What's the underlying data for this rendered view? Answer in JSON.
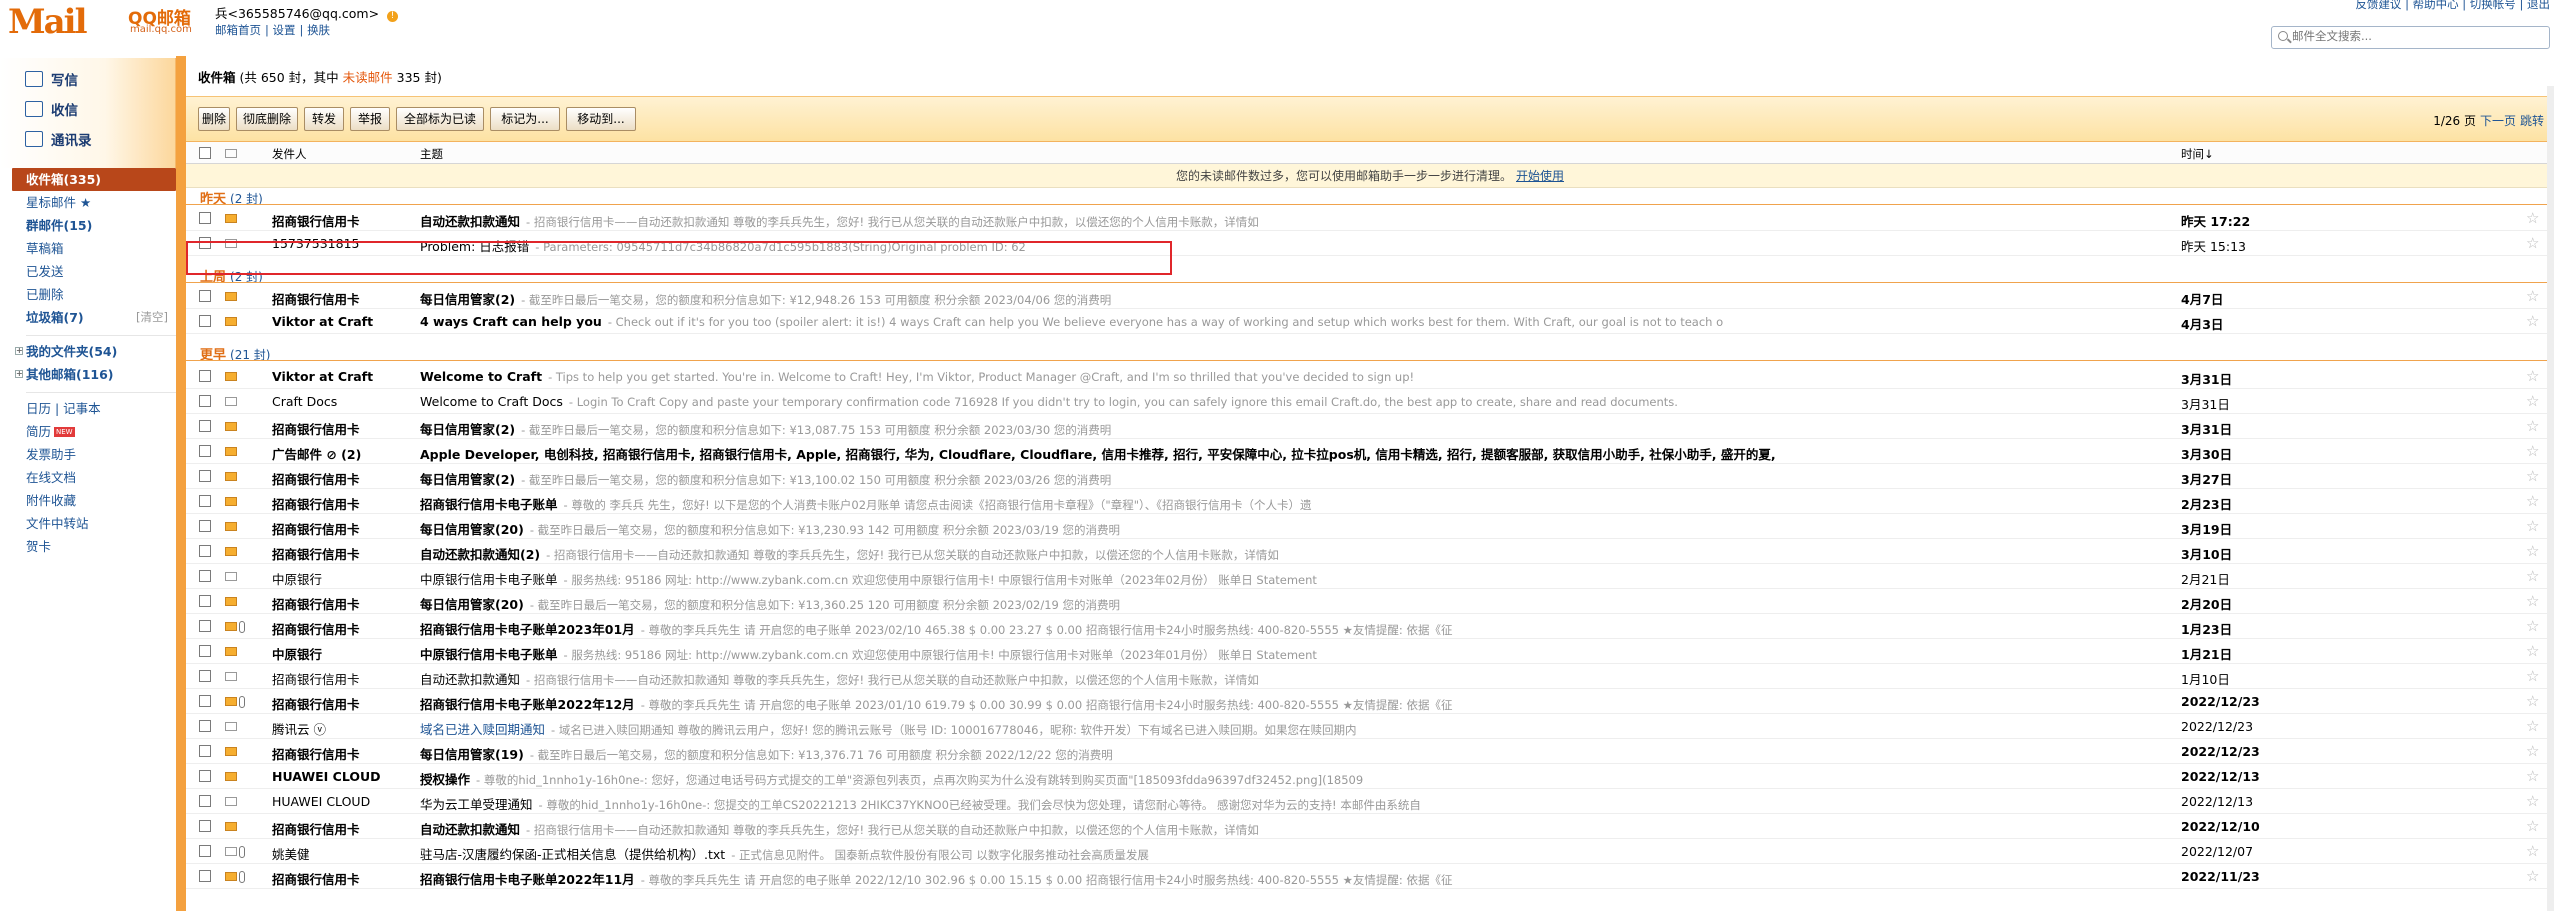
{
  "header": {
    "logo_mark": "Mail",
    "logo_name": "QQ邮箱",
    "logo_domain": "mail.qq.com",
    "account": "兵<365585746@qq.com>",
    "account_links": [
      "邮箱首页",
      "设置",
      "换肤"
    ],
    "top_links": "反馈建议 | 帮助中心 | 切换帐号 | 退出",
    "search_placeholder": "邮件全文搜索..."
  },
  "sidebar": {
    "actions": [
      {
        "label": "写信",
        "icon": "pencil-icon"
      },
      {
        "label": "收信",
        "icon": "inbox-icon"
      },
      {
        "label": "通讯录",
        "icon": "contacts-icon"
      }
    ],
    "folders": [
      {
        "label": "收件箱(335)",
        "selected": true
      },
      {
        "label": "星标邮件 ★"
      },
      {
        "label": "群邮件(15)",
        "bold": true
      },
      {
        "label": "草稿箱"
      },
      {
        "label": "已发送"
      },
      {
        "label": "已删除"
      },
      {
        "label": "垃圾箱(7)",
        "bold": true,
        "extra": "[清空]"
      }
    ],
    "groups": [
      {
        "label": "我的文件夹(54)",
        "bold": true
      },
      {
        "label": "其他邮箱(116)",
        "bold": true
      }
    ],
    "tools": [
      "日历 | 记事本",
      "简历",
      "发票助手",
      "在线文档",
      "附件收藏",
      "文件中转站",
      "贺卡"
    ],
    "new_badge": "NEW"
  },
  "inbox": {
    "title": "收件箱",
    "count_text": "(共 650 封，其中 ",
    "unread_link": "未读邮件",
    "unread_text": " 335 封)",
    "buttons": [
      "删除",
      "彻底删除",
      "转发",
      "举报",
      "全部标为已读",
      "标记为...",
      "移动到..."
    ],
    "pager": "1/26 页",
    "pager_links": [
      "下一页",
      "跳转"
    ],
    "columns": {
      "from": "发件人",
      "subject": "主题",
      "time": "时间↓"
    },
    "banner": "您的未读邮件数过多，您可以使用邮箱助手一步一步进行清理。",
    "banner_link": "开始使用",
    "groups": [
      {
        "label": "昨天",
        "count": "(2 封)"
      },
      {
        "label": "上周",
        "count": "(2 封)"
      },
      {
        "label": "更早",
        "count": "(21 封)"
      }
    ],
    "rows": [
      {
        "from": "招商银行信用卡",
        "subject": "自动还款扣款通知",
        "summary": "- 招商银行信用卡——自动还款扣款通知   尊敬的李兵兵先生，您好!           我行已从您关联的自动还款账户中扣款，以偿还您的个人信用卡账款，详情如",
        "time": "昨天 17:22",
        "unread": true
      },
      {
        "from": "15737531815",
        "subject": "Problem: 日志报错",
        "summary": "- Parameters: 09545711d7c34b86820a7d1c595b1883(String)Original problem ID: 62",
        "time": "昨天 15:13",
        "unread": false
      },
      {
        "from": "招商银行信用卡",
        "subject": "每日信用管家(2)",
        "summary": "- 截至昨日最后一笔交易，您的额度和积分信息如下:        ¥12,948.26        153          可用额度        积分余额                                  2023/04/06 您的消费明",
        "time": "4月7日",
        "unread": true
      },
      {
        "from": "Viktor at Craft",
        "subject": "4 ways Craft can help you",
        "summary": "- Check out if it's for you too (spoiler alert: it is!)   4 ways Craft can help you   We believe everyone has a way of working and setup which works best for them. With Craft, our goal is not to teach o",
        "time": "4月3日",
        "unread": true
      },
      {
        "from": "Viktor at Craft",
        "subject": "Welcome to Craft",
        "summary": "- Tips to help you get started.    You're in. Welcome to Craft!                Hey,               I'm Viktor, Product Manager @Craft, and I'm so thrilled that you've decided to sign up!",
        "time": "3月31日",
        "unread": true
      },
      {
        "from": "Craft Docs",
        "subject": "Welcome to Craft Docs",
        "summary": "- Login To Craft Copy and paste your temporary confirmation code 716928 If you didn't try to login, you can safely ignore this email Craft.do, the best app to create, share and read documents.",
        "time": "3月31日",
        "unread": false
      },
      {
        "from": "招商银行信用卡",
        "subject": "每日信用管家(2)",
        "summary": "- 截至昨日最后一笔交易，您的额度和积分信息如下:        ¥13,087.75        153          可用额度        积分余额                                  2023/03/30 您的消费明",
        "time": "3月31日",
        "unread": true
      },
      {
        "from": "广告邮件 ⊘ (2)",
        "subject": "Apple Developer, 电创科技, 招商银行信用卡, 招商银行信用卡, Apple, 招商银行, 华为, Cloudflare, Cloudflare, 信用卡推荐, 招行, 平安保障中心, 拉卡拉pos机, 信用卡精选, 招行, 提额客服部, 获取信用小助手, 社保小助手, 盛开的夏,",
        "summary": "",
        "time": "3月30日",
        "unread": true
      },
      {
        "from": "招商银行信用卡",
        "subject": "每日信用管家(2)",
        "summary": "- 截至昨日最后一笔交易，您的额度和积分信息如下:        ¥13,100.02        150          可用额度        积分余额                                  2023/03/26 您的消费明",
        "time": "3月27日",
        "unread": true
      },
      {
        "from": "招商银行信用卡",
        "subject": "招商银行信用卡电子账单",
        "summary": "- 尊敬的 李兵兵 先生，您好! 以下是您的个人消费卡账户02月账单   请您点击阅读《招商银行信用卡章程》（\"章程\"）、《招商银行信用卡（个人卡）遗",
        "time": "2月23日",
        "unread": true
      },
      {
        "from": "招商银行信用卡",
        "subject": "每日信用管家(20)",
        "summary": "- 截至昨日最后一笔交易，您的额度和积分信息如下:        ¥13,230.93        142          可用额度        积分余额                                  2023/03/19 您的消费明",
        "time": "3月19日",
        "unread": true
      },
      {
        "from": "招商银行信用卡",
        "subject": "自动还款扣款通知(2)",
        "summary": "- 招商银行信用卡——自动还款扣款通知   尊敬的李兵兵先生，您好!           我行已从您关联的自动还款账户中扣款，以偿还您的个人信用卡账款，详情如",
        "time": "3月10日",
        "unread": true
      },
      {
        "from": "中原银行",
        "subject": "中原银行信用卡电子账单",
        "summary": "-               服务热线: 95186        网址: http://www.zybank.com.cn       欢迎您使用中原银行信用卡!              中原银行信用卡对账单（2023年02月份）       账单日 Statement",
        "time": "2月21日",
        "unread": false
      },
      {
        "from": "招商银行信用卡",
        "subject": "每日信用管家(20)",
        "summary": "- 截至昨日最后一笔交易，您的额度和积分信息如下:        ¥13,360.25        120          可用额度        积分余额                                  2023/02/19 您的消费明",
        "time": "2月20日",
        "unread": true
      },
      {
        "from": "招商银行信用卡",
        "subject": "招商银行信用卡电子账单2023年01月",
        "summary": "- 尊敬的李兵兵先生    请    开启您的电子账单    2023/02/10    465.38    $ 0.00     23.27    $ 0.00    招商银行信用卡24小时服务热线: 400-820-5555   ★友情提醒: 依据《征",
        "time": "1月23日",
        "unread": true,
        "clip": true
      },
      {
        "from": "中原银行",
        "subject": "中原银行信用卡电子账单",
        "summary": "-               服务热线: 95186        网址: http://www.zybank.com.cn       欢迎您使用中原银行信用卡!              中原银行信用卡对账单（2023年01月份）       账单日 Statement",
        "time": "1月21日",
        "unread": true
      },
      {
        "from": "招商银行信用卡",
        "subject": "自动还款扣款通知",
        "summary": "- 招商银行信用卡——自动还款扣款通知   尊敬的李兵兵先生，您好!           我行已从您关联的自动还款账户中扣款，以偿还您的个人信用卡账款，详情如",
        "time": "1月10日",
        "unread": false
      },
      {
        "from": "招商银行信用卡",
        "subject": "招商银行信用卡电子账单2022年12月",
        "summary": "- 尊敬的李兵兵先生    请    开启您的电子账单    2023/01/10    619.79    $ 0.00     30.99    $ 0.00    招商银行信用卡24小时服务热线: 400-820-5555   ★友情提醒: 依据《征",
        "time": "2022/12/23",
        "unread": true,
        "clip": true
      },
      {
        "from": "腾讯云 ⓥ",
        "subject": "域名已进入赎回期通知",
        "summary": "- 域名已进入赎回期通知   尊敬的腾讯云用户，您好!   您的腾讯云账号（账号 ID: 100016778046，昵称: 软件开发）下有域名已进入赎回期。如果您在赎回期内",
        "time": "2022/12/23",
        "unread": false,
        "link": true
      },
      {
        "from": "招商银行信用卡",
        "subject": "每日信用管家(19)",
        "summary": "- 截至昨日最后一笔交易，您的额度和积分信息如下:        ¥13,376.71        76           可用额度        积分余额                                  2022/12/22 您的消费明",
        "time": "2022/12/23",
        "unread": true
      },
      {
        "from": "HUAWEI CLOUD",
        "subject": "授权操作",
        "summary": "- 尊敬的hid_1nnho1y-16h0ne-:            您好，您通过电话号码方式提交的工单\"资源包列表页，点再次购买为什么没有跳转到购买页面\"[185093fdda96397df32452.png](18509",
        "time": "2022/12/13",
        "unread": true
      },
      {
        "from": "HUAWEI CLOUD",
        "subject": "华为云工单受理通知",
        "summary": "- 尊敬的hid_1nnho1y-16h0ne-:    您提交的工单CS20221213 2HIKC37YKNO0已经被受理。我们会尽快为您处理，请您耐心等待。  感谢您对华为云的支持!       本邮件由系统自",
        "time": "2022/12/13",
        "unread": false
      },
      {
        "from": "招商银行信用卡",
        "subject": "自动还款扣款通知",
        "summary": "- 招商银行信用卡——自动还款扣款通知   尊敬的李兵兵先生，您好!           我行已从您关联的自动还款账户中扣款，以偿还您的个人信用卡账款，详情如",
        "time": "2022/12/10",
        "unread": true
      },
      {
        "from": "姚美健",
        "subject": "驻马店-汉唐履约保函-正式相关信息（提供给机构）.txt",
        "summary": "- 正式信息见附件。      国泰新点软件股份有限公司             以数字化服务推动社会高质量发展",
        "time": "2022/12/07",
        "unread": false,
        "clip": true
      },
      {
        "from": "招商银行信用卡",
        "subject": "招商银行信用卡电子账单2022年11月",
        "summary": "- 尊敬的李兵兵先生    请    开启您的电子账单    2022/12/10    302.96    $ 0.00     15.15    $ 0.00    招商银行信用卡24小时服务热线: 400-820-5555   ★友情提醒: 依据《征",
        "time": "2022/11/23",
        "unread": true,
        "clip": true
      }
    ]
  },
  "colors": {
    "accent": "#f4a13f",
    "brand": "#e36b09",
    "link": "#1e5494",
    "highlight": "#e0262b"
  }
}
